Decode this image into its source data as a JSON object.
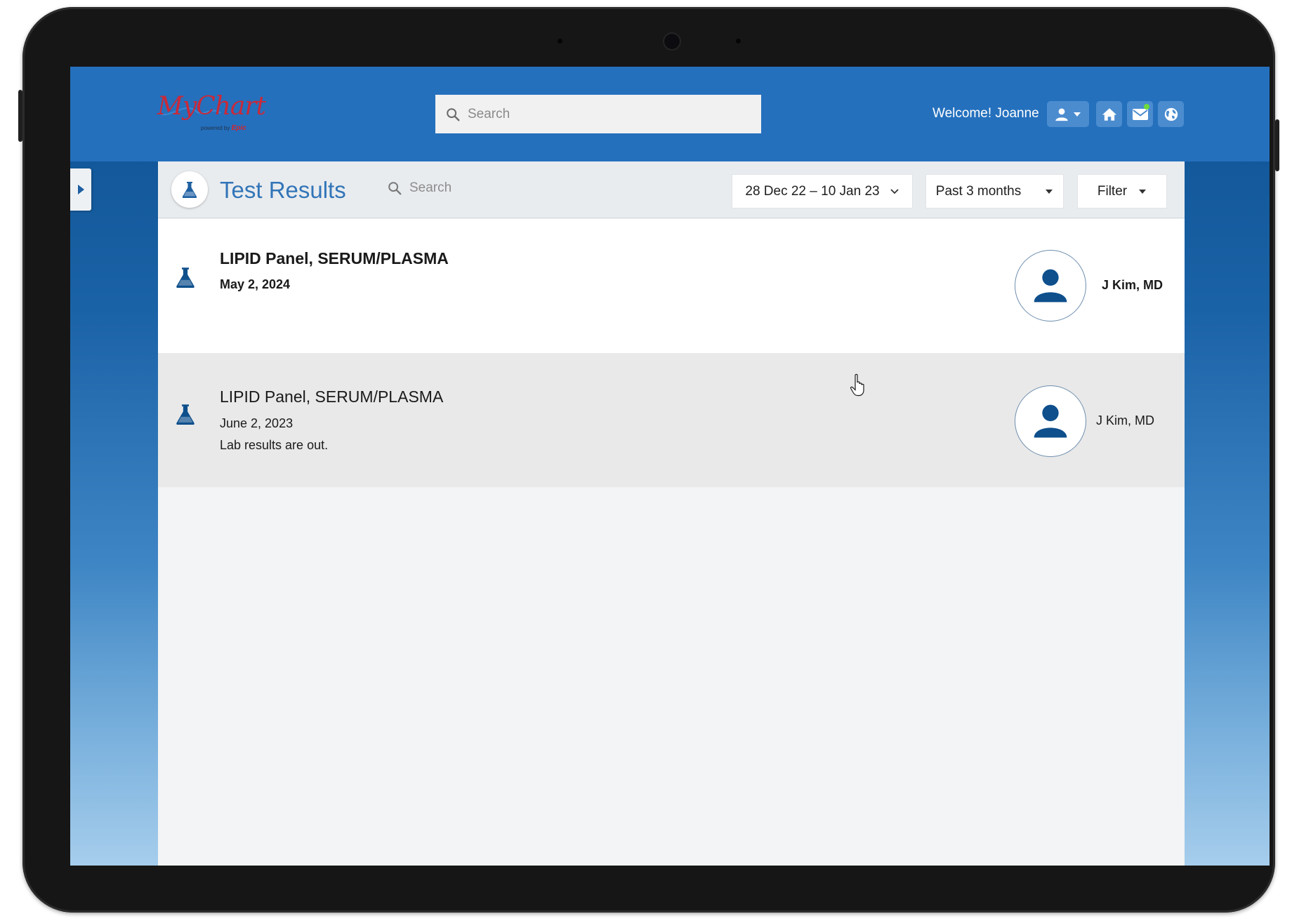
{
  "app": {
    "logo_text": "MyChart",
    "logo_powered_by": "powered by",
    "logo_brand": "Epic"
  },
  "topbar": {
    "search_placeholder": "Search",
    "welcome": "Welcome! Joanne",
    "icons": [
      "user-icon",
      "caret-down-icon",
      "home-icon",
      "mail-icon",
      "globe-icon"
    ],
    "mail_notification_color": "#6ddc3a"
  },
  "page": {
    "title": "Test Results",
    "search_placeholder": "Search",
    "date_range": "28 Dec 22 – 10 Jan 23",
    "period": "Past 3 months",
    "filter": "Filter"
  },
  "results": [
    {
      "title": "LIPID Panel, SERUM/PLASMA",
      "date": "May 2, 2024",
      "note": "",
      "provider": "J Kim, MD",
      "unread": true
    },
    {
      "title": "LIPID Panel, SERUM/PLASMA",
      "date": "June 2, 2023",
      "note": "Lab results are out.",
      "provider": "J Kim, MD",
      "unread": false
    }
  ],
  "colors": {
    "topbar": "#2470bd",
    "accent": "#3275b8",
    "icon": "#0e4f8c",
    "logo_red": "#c9293a"
  }
}
